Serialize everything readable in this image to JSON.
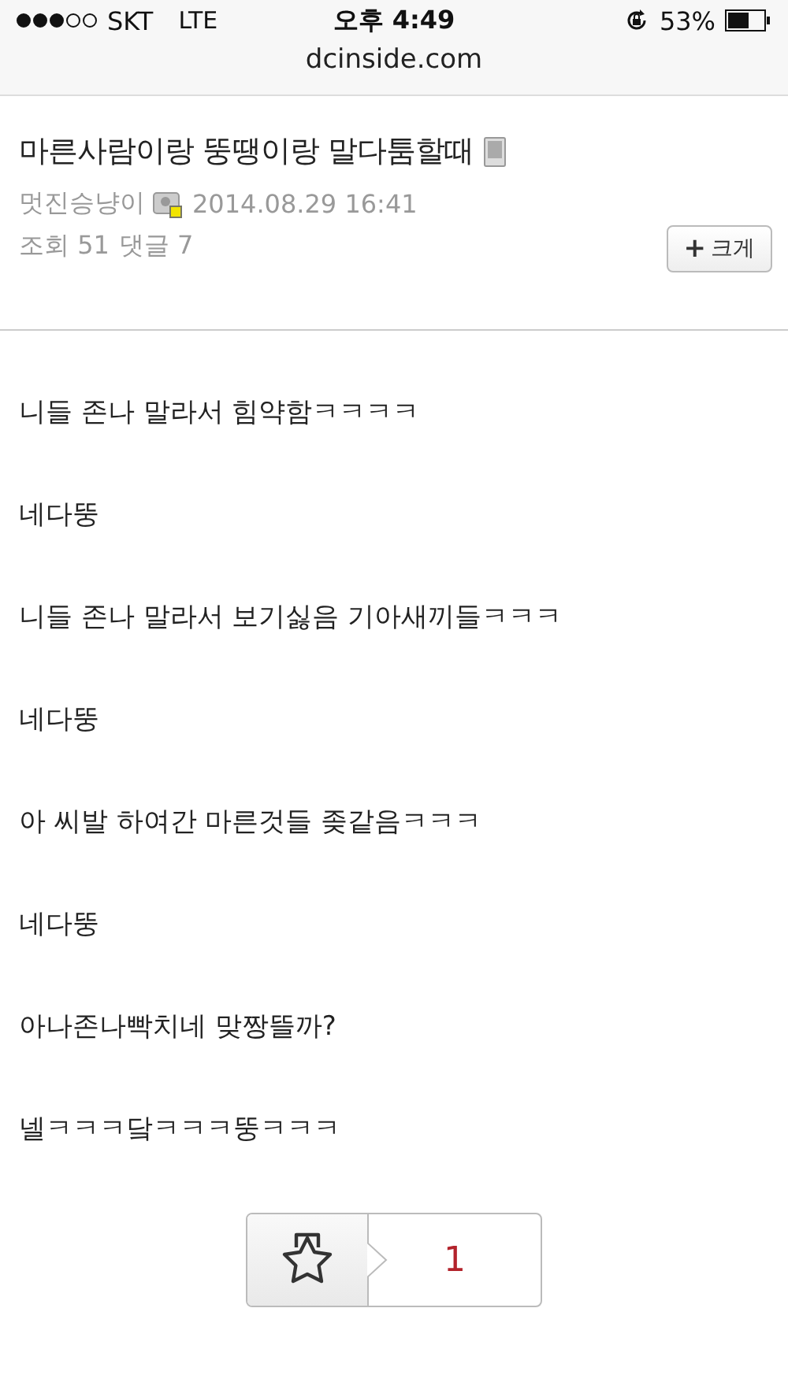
{
  "status_bar": {
    "carrier": "SKT",
    "network": "LTE",
    "time": "오후 4:49",
    "battery": "53%"
  },
  "address_bar": {
    "url": "dcinside.com"
  },
  "post": {
    "title": "마른사람이랑 뚱땡이랑 말다툼할때",
    "author": "멋진승냥이",
    "date": "2014.08.29 16:41",
    "views_label": "조회",
    "views": "51",
    "comments_label": "댓글",
    "comments": "7",
    "enlarge_button": {
      "icon": "+",
      "label": "크게"
    },
    "lines": [
      "니들 존나 말라서 힘약함ㅋㅋㅋㅋ",
      "네다뚱",
      "니들 존나 말라서 보기싫음 기아새끼들ㅋㅋㅋ",
      "네다뚱",
      "아 씨발 하여간 마른것들 좆같음ㅋㅋㅋ",
      "네다뚱",
      "아나존나빡치네 맞짱뜰까?",
      "넬ㅋㅋㅋ닼ㅋㅋㅋ뚱ㅋㅋㅋ"
    ],
    "recommend": {
      "count": "1"
    }
  }
}
